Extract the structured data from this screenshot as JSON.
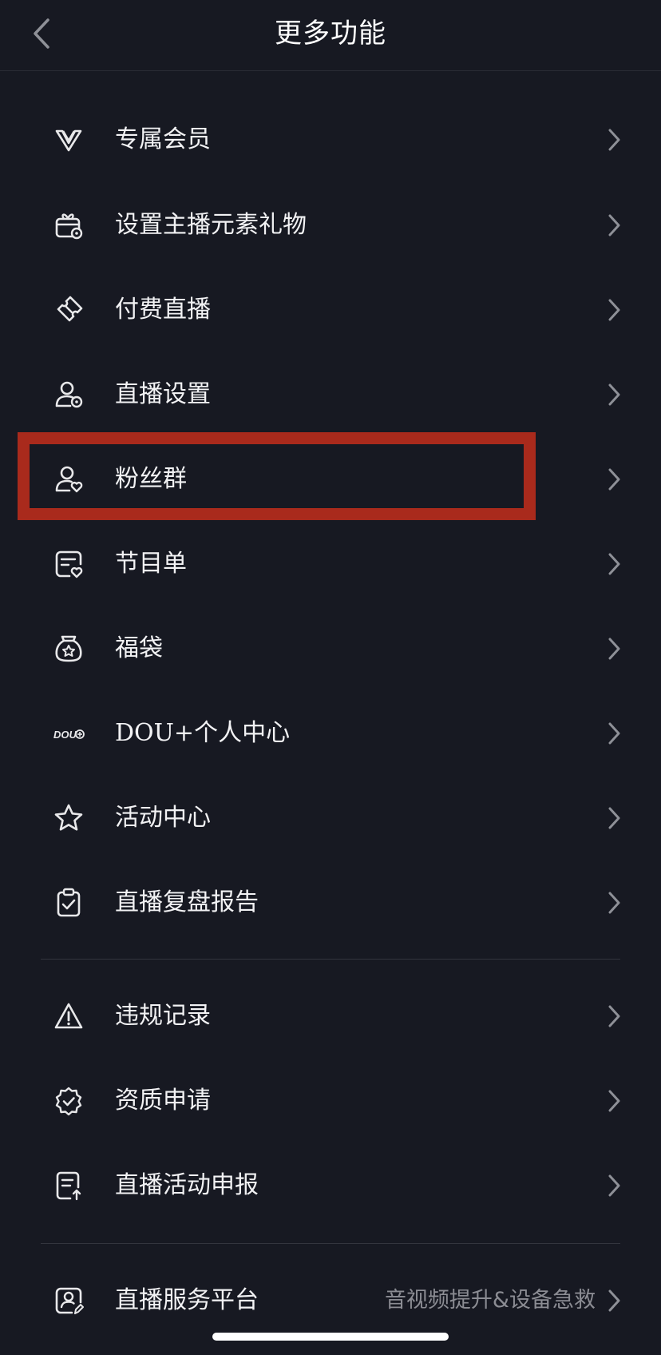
{
  "header": {
    "title": "更多功能"
  },
  "menu": [
    {
      "label": "专属会员",
      "icon": "vip-v-icon"
    },
    {
      "label": "设置主播元素礼物",
      "icon": "gift-settings-icon"
    },
    {
      "label": "付费直播",
      "icon": "ticket-icon"
    },
    {
      "label": "直播设置",
      "icon": "user-settings-icon"
    },
    {
      "label": "粉丝群",
      "icon": "fan-group-icon"
    },
    {
      "label": "节目单",
      "icon": "program-list-icon"
    },
    {
      "label": "福袋",
      "icon": "lucky-bag-icon"
    },
    {
      "label": "DOU+个人中心",
      "icon": "dou-plus-icon"
    },
    {
      "label": "活动中心",
      "icon": "star-icon"
    },
    {
      "label": "直播复盘报告",
      "icon": "clipboard-check-icon"
    },
    {
      "label": "违规记录",
      "icon": "warning-icon"
    },
    {
      "label": "资质申请",
      "icon": "badge-check-icon"
    },
    {
      "label": "直播活动申报",
      "icon": "document-upload-icon"
    },
    {
      "label": "直播服务平台",
      "icon": "service-platform-icon",
      "subtitle": "音视频提升&设备急救"
    }
  ],
  "dou_logo_text": "DOU",
  "colors": {
    "background": "#171922",
    "highlight": "#a92a1c",
    "text": "#f2f2f4",
    "subtext": "#8b8c93"
  }
}
